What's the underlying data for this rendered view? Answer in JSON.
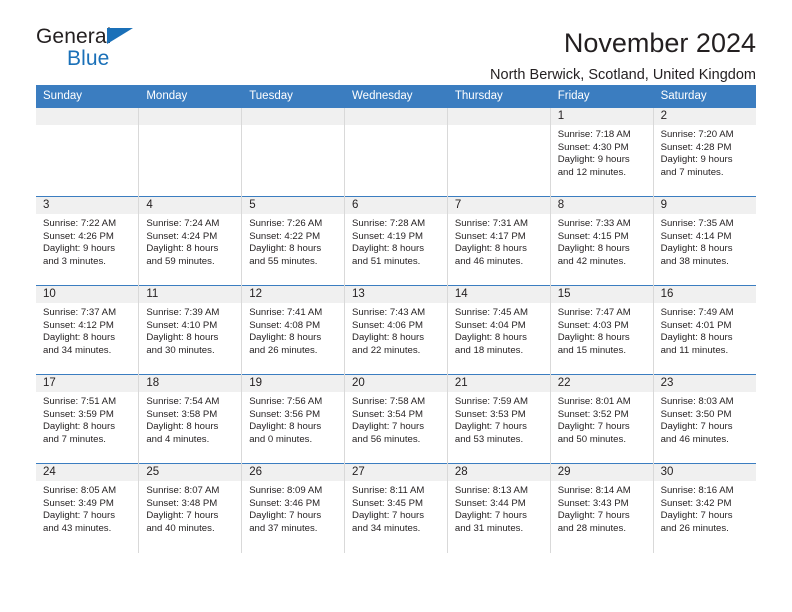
{
  "brand": {
    "name_part1": "General",
    "name_part2": "Blue",
    "triangle_color": "#1a70b8",
    "text_color": "#231f20"
  },
  "header": {
    "title": "November 2024",
    "subtitle": "North Berwick, Scotland, United Kingdom"
  },
  "theme": {
    "header_bg": "#3b7dc0",
    "header_text": "#ffffff",
    "daynum_bg": "#f0f0f0",
    "cell_bg": "#ffffff",
    "row_divider": "#3b7dc0",
    "col_divider": "#d9d9d9"
  },
  "calendar": {
    "weekday_headers": [
      "Sunday",
      "Monday",
      "Tuesday",
      "Wednesday",
      "Thursday",
      "Friday",
      "Saturday"
    ],
    "weeks": [
      [
        {
          "day": "",
          "lines": []
        },
        {
          "day": "",
          "lines": []
        },
        {
          "day": "",
          "lines": []
        },
        {
          "day": "",
          "lines": []
        },
        {
          "day": "",
          "lines": []
        },
        {
          "day": "1",
          "lines": [
            "Sunrise: 7:18 AM",
            "Sunset: 4:30 PM",
            "Daylight: 9 hours",
            "and 12 minutes."
          ]
        },
        {
          "day": "2",
          "lines": [
            "Sunrise: 7:20 AM",
            "Sunset: 4:28 PM",
            "Daylight: 9 hours",
            "and 7 minutes."
          ]
        }
      ],
      [
        {
          "day": "3",
          "lines": [
            "Sunrise: 7:22 AM",
            "Sunset: 4:26 PM",
            "Daylight: 9 hours",
            "and 3 minutes."
          ]
        },
        {
          "day": "4",
          "lines": [
            "Sunrise: 7:24 AM",
            "Sunset: 4:24 PM",
            "Daylight: 8 hours",
            "and 59 minutes."
          ]
        },
        {
          "day": "5",
          "lines": [
            "Sunrise: 7:26 AM",
            "Sunset: 4:22 PM",
            "Daylight: 8 hours",
            "and 55 minutes."
          ]
        },
        {
          "day": "6",
          "lines": [
            "Sunrise: 7:28 AM",
            "Sunset: 4:19 PM",
            "Daylight: 8 hours",
            "and 51 minutes."
          ]
        },
        {
          "day": "7",
          "lines": [
            "Sunrise: 7:31 AM",
            "Sunset: 4:17 PM",
            "Daylight: 8 hours",
            "and 46 minutes."
          ]
        },
        {
          "day": "8",
          "lines": [
            "Sunrise: 7:33 AM",
            "Sunset: 4:15 PM",
            "Daylight: 8 hours",
            "and 42 minutes."
          ]
        },
        {
          "day": "9",
          "lines": [
            "Sunrise: 7:35 AM",
            "Sunset: 4:14 PM",
            "Daylight: 8 hours",
            "and 38 minutes."
          ]
        }
      ],
      [
        {
          "day": "10",
          "lines": [
            "Sunrise: 7:37 AM",
            "Sunset: 4:12 PM",
            "Daylight: 8 hours",
            "and 34 minutes."
          ]
        },
        {
          "day": "11",
          "lines": [
            "Sunrise: 7:39 AM",
            "Sunset: 4:10 PM",
            "Daylight: 8 hours",
            "and 30 minutes."
          ]
        },
        {
          "day": "12",
          "lines": [
            "Sunrise: 7:41 AM",
            "Sunset: 4:08 PM",
            "Daylight: 8 hours",
            "and 26 minutes."
          ]
        },
        {
          "day": "13",
          "lines": [
            "Sunrise: 7:43 AM",
            "Sunset: 4:06 PM",
            "Daylight: 8 hours",
            "and 22 minutes."
          ]
        },
        {
          "day": "14",
          "lines": [
            "Sunrise: 7:45 AM",
            "Sunset: 4:04 PM",
            "Daylight: 8 hours",
            "and 18 minutes."
          ]
        },
        {
          "day": "15",
          "lines": [
            "Sunrise: 7:47 AM",
            "Sunset: 4:03 PM",
            "Daylight: 8 hours",
            "and 15 minutes."
          ]
        },
        {
          "day": "16",
          "lines": [
            "Sunrise: 7:49 AM",
            "Sunset: 4:01 PM",
            "Daylight: 8 hours",
            "and 11 minutes."
          ]
        }
      ],
      [
        {
          "day": "17",
          "lines": [
            "Sunrise: 7:51 AM",
            "Sunset: 3:59 PM",
            "Daylight: 8 hours",
            "and 7 minutes."
          ]
        },
        {
          "day": "18",
          "lines": [
            "Sunrise: 7:54 AM",
            "Sunset: 3:58 PM",
            "Daylight: 8 hours",
            "and 4 minutes."
          ]
        },
        {
          "day": "19",
          "lines": [
            "Sunrise: 7:56 AM",
            "Sunset: 3:56 PM",
            "Daylight: 8 hours",
            "and 0 minutes."
          ]
        },
        {
          "day": "20",
          "lines": [
            "Sunrise: 7:58 AM",
            "Sunset: 3:54 PM",
            "Daylight: 7 hours",
            "and 56 minutes."
          ]
        },
        {
          "day": "21",
          "lines": [
            "Sunrise: 7:59 AM",
            "Sunset: 3:53 PM",
            "Daylight: 7 hours",
            "and 53 minutes."
          ]
        },
        {
          "day": "22",
          "lines": [
            "Sunrise: 8:01 AM",
            "Sunset: 3:52 PM",
            "Daylight: 7 hours",
            "and 50 minutes."
          ]
        },
        {
          "day": "23",
          "lines": [
            "Sunrise: 8:03 AM",
            "Sunset: 3:50 PM",
            "Daylight: 7 hours",
            "and 46 minutes."
          ]
        }
      ],
      [
        {
          "day": "24",
          "lines": [
            "Sunrise: 8:05 AM",
            "Sunset: 3:49 PM",
            "Daylight: 7 hours",
            "and 43 minutes."
          ]
        },
        {
          "day": "25",
          "lines": [
            "Sunrise: 8:07 AM",
            "Sunset: 3:48 PM",
            "Daylight: 7 hours",
            "and 40 minutes."
          ]
        },
        {
          "day": "26",
          "lines": [
            "Sunrise: 8:09 AM",
            "Sunset: 3:46 PM",
            "Daylight: 7 hours",
            "and 37 minutes."
          ]
        },
        {
          "day": "27",
          "lines": [
            "Sunrise: 8:11 AM",
            "Sunset: 3:45 PM",
            "Daylight: 7 hours",
            "and 34 minutes."
          ]
        },
        {
          "day": "28",
          "lines": [
            "Sunrise: 8:13 AM",
            "Sunset: 3:44 PM",
            "Daylight: 7 hours",
            "and 31 minutes."
          ]
        },
        {
          "day": "29",
          "lines": [
            "Sunrise: 8:14 AM",
            "Sunset: 3:43 PM",
            "Daylight: 7 hours",
            "and 28 minutes."
          ]
        },
        {
          "day": "30",
          "lines": [
            "Sunrise: 8:16 AM",
            "Sunset: 3:42 PM",
            "Daylight: 7 hours",
            "and 26 minutes."
          ]
        }
      ]
    ]
  }
}
